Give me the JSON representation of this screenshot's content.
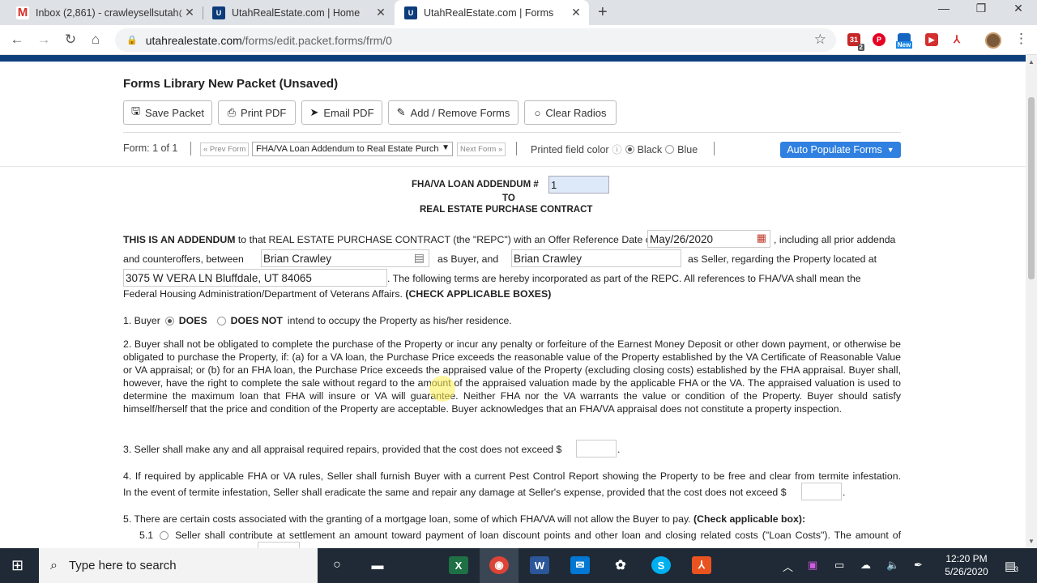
{
  "browser": {
    "tabs": [
      {
        "title": "Inbox (2,861) - crawleysellsutah@",
        "favicon": "gmail-icon"
      },
      {
        "title": "UtahRealEstate.com | Home",
        "favicon": "utah-icon"
      },
      {
        "title": "UtahRealEstate.com | Forms",
        "favicon": "utah-icon"
      }
    ],
    "url_host": "utahrealestate.com",
    "url_path": "/forms/edit.packet.forms/frm/0",
    "ext_badge": "2",
    "ext_new": "New"
  },
  "page": {
    "title": "Forms Library New Packet (Unsaved)",
    "buttons": {
      "save": "Save Packet",
      "print": "Print PDF",
      "email": "Email PDF",
      "add_remove": "Add / Remove Forms",
      "clear": "Clear Radios"
    },
    "form_count": "Form: 1 of 1",
    "prev_form": "« Prev Form",
    "next_form": "Next Form »",
    "form_select": "FHA/VA Loan Addendum to Real Estate Purch",
    "printed_color_label": "Printed field color",
    "color_black": "Black",
    "color_blue": "Blue",
    "auto_populate": "Auto Populate Forms",
    "accent": "#2f80e0",
    "brand_bar": "#0d3f7a"
  },
  "doc": {
    "title1": "FHA/VA LOAN ADDENDUM #",
    "addendum_no": "1",
    "title2": "TO",
    "title3": "REAL ESTATE PURCHASE CONTRACT",
    "p_intro_bold": "THIS IS AN ADDENDUM",
    "p_intro_a": "to that REAL ESTATE PURCHASE CONTRACT (the \"REPC\") with an Offer Reference Date of",
    "offer_date": "May/26/2020",
    "p_intro_b": ", including all prior addenda",
    "p_intro_c": "and counteroffers, between",
    "buyer": "Brian Crawley",
    "p_intro_d": "as Buyer, and",
    "seller": "Brian Crawley",
    "p_intro_e": "as Seller, regarding the Property located at",
    "property": "3075 W VERA LN Bluffdale, UT 84065",
    "p_intro_f": ". The following terms are hereby incorporated as part of the REPC. All references to FHA/VA shall mean the",
    "p_intro_g": "Federal Housing Administration/Department of Veterans Affairs.",
    "p_intro_h": "(CHECK APPLICABLE BOXES)",
    "s1_a": "1.  Buyer",
    "s1_does": "DOES",
    "s1_doesnot": "DOES NOT",
    "s1_b": "intend to occupy the Property as his/her residence.",
    "s2": "2.  Buyer shall not be obligated to complete the purchase of the Property or incur any penalty or forfeiture of the Earnest Money Deposit or other down payment, or otherwise be obligated to purchase the Property, if: (a) for a VA loan, the Purchase Price exceeds the reasonable value of the Property established by the VA Certificate of Reasonable Value or VA appraisal; or (b) for an FHA loan, the Purchase Price exceeds the appraised value of the Property (excluding closing costs) established by the FHA appraisal. Buyer shall, however, have the right to complete the sale without regard to the amount of the appraised valuation made by the applicable FHA or the VA. The appraised valuation is used to determine the maximum loan that FHA will insure or VA will guarantee. Neither FHA nor the VA warrants the value or condition of the Property. Buyer should satisfy himself/herself that the price and condition of the Property are acceptable. Buyer acknowledges that an FHA/VA appraisal does not constitute a property inspection.",
    "s3": "3.  Seller shall make any and all appraisal required repairs, provided that the cost does not exceed $",
    "s4_a": "4.  If required by applicable FHA or VA rules, Seller shall furnish Buyer with a current Pest Control Report showing the Property to be free and clear from termite infestation.",
    "s4_b": "In the event of termite infestation, Seller shall eradicate the same and repair any damage at Seller's expense, provided that the cost does not exceed $",
    "s5_a": "5.  There are certain costs associated with the granting of a mortgage loan, some of which FHA/VA will not allow the Buyer to pay.",
    "s5_bold": "(Check applicable box):",
    "s51_no": "5.1",
    "s51": "Seller shall contribute at settlement an amount toward payment of loan discount points and other loan and closing related costs (\"Loan Costs\"). The amount of"
  },
  "taskbar": {
    "search_placeholder": "Type here to search",
    "time": "12:20 PM",
    "date": "5/26/2020",
    "notif_count": "3"
  }
}
